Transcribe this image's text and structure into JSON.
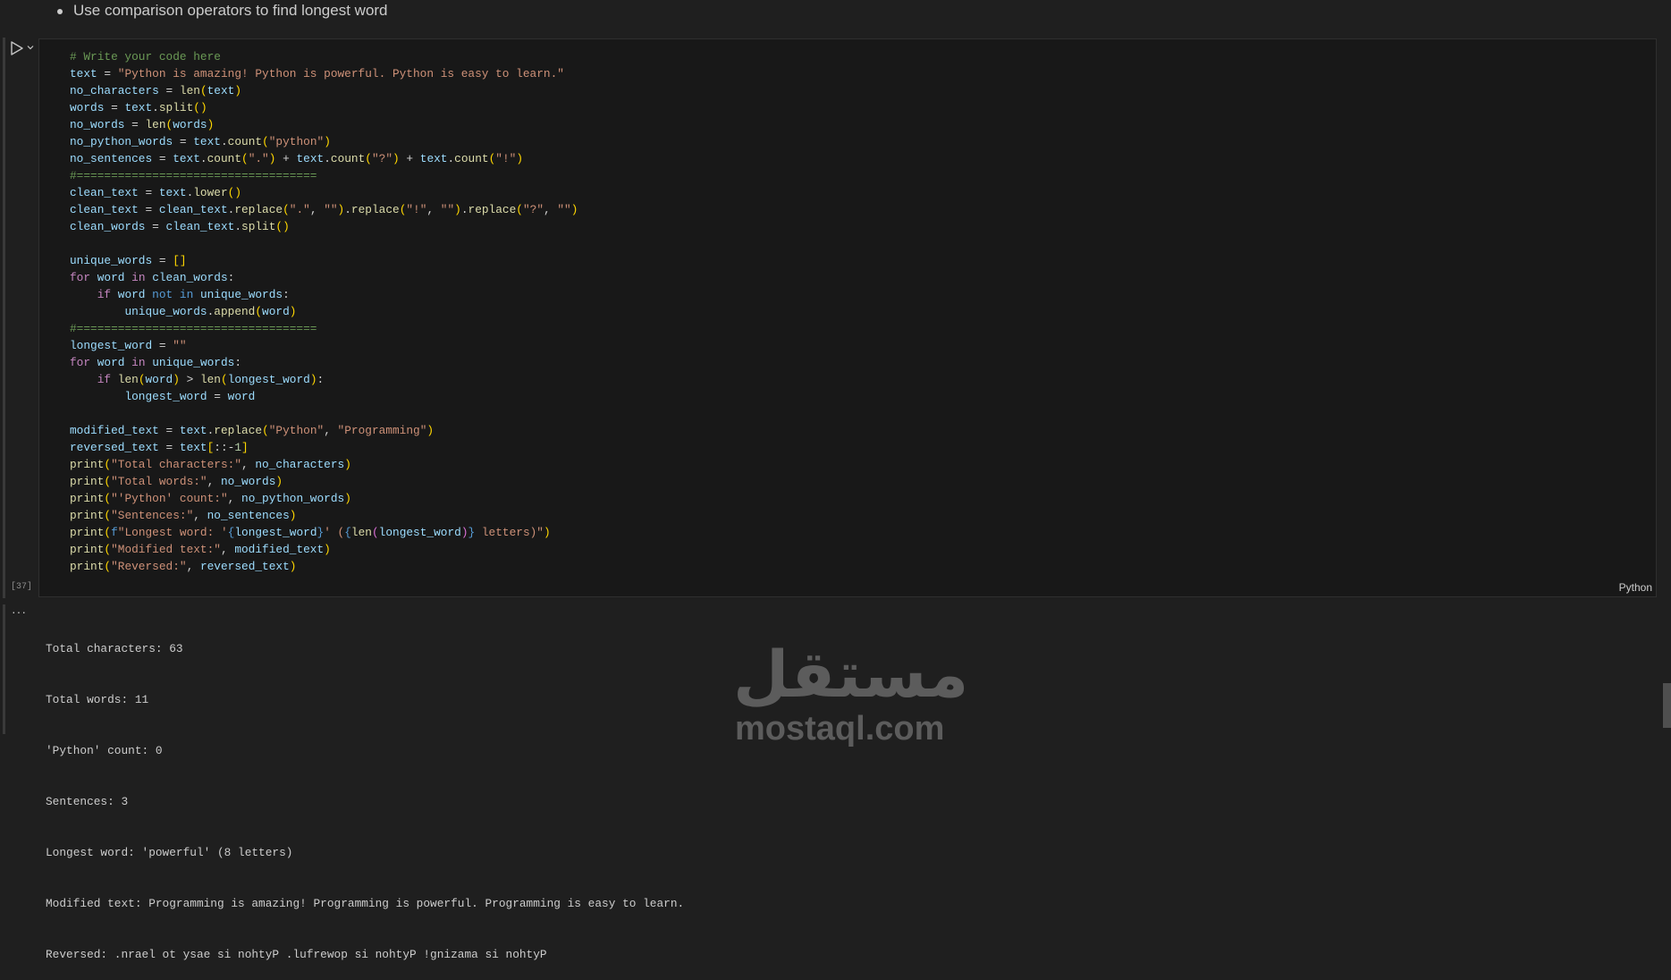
{
  "markdown": {
    "bullet_text": "Use comparison operators to find longest word"
  },
  "cell": {
    "execution_count": "[37]",
    "language": "Python",
    "code_lines": [
      [
        [
          "# Write your code here",
          "c"
        ]
      ],
      [
        [
          "text",
          "v"
        ],
        [
          " = ",
          "p"
        ],
        [
          "\"Python is amazing! Python is powerful. Python is easy to learn.\"",
          "s"
        ]
      ],
      [
        [
          "no_characters",
          "v"
        ],
        [
          " = ",
          "p"
        ],
        [
          "len",
          "f"
        ],
        [
          "(",
          "y"
        ],
        [
          "text",
          "v"
        ],
        [
          ")",
          "y"
        ]
      ],
      [
        [
          "words",
          "v"
        ],
        [
          " = ",
          "p"
        ],
        [
          "text",
          "v"
        ],
        [
          ".",
          "p"
        ],
        [
          "split",
          "f"
        ],
        [
          "()",
          "y"
        ]
      ],
      [
        [
          "no_words",
          "v"
        ],
        [
          " = ",
          "p"
        ],
        [
          "len",
          "f"
        ],
        [
          "(",
          "y"
        ],
        [
          "words",
          "v"
        ],
        [
          ")",
          "y"
        ]
      ],
      [
        [
          "no_python_words",
          "v"
        ],
        [
          " = ",
          "p"
        ],
        [
          "text",
          "v"
        ],
        [
          ".",
          "p"
        ],
        [
          "count",
          "f"
        ],
        [
          "(",
          "y"
        ],
        [
          "\"python\"",
          "s"
        ],
        [
          ")",
          "y"
        ]
      ],
      [
        [
          "no_sentences",
          "v"
        ],
        [
          " = ",
          "p"
        ],
        [
          "text",
          "v"
        ],
        [
          ".",
          "p"
        ],
        [
          "count",
          "f"
        ],
        [
          "(",
          "y"
        ],
        [
          "\".\"",
          "s"
        ],
        [
          ")",
          "y"
        ],
        [
          " + ",
          "p"
        ],
        [
          "text",
          "v"
        ],
        [
          ".",
          "p"
        ],
        [
          "count",
          "f"
        ],
        [
          "(",
          "y"
        ],
        [
          "\"?\"",
          "s"
        ],
        [
          ")",
          "y"
        ],
        [
          " + ",
          "p"
        ],
        [
          "text",
          "v"
        ],
        [
          ".",
          "p"
        ],
        [
          "count",
          "f"
        ],
        [
          "(",
          "y"
        ],
        [
          "\"!\"",
          "s"
        ],
        [
          ")",
          "y"
        ]
      ],
      [
        [
          "#===================================",
          "c"
        ]
      ],
      [
        [
          "clean_text",
          "v"
        ],
        [
          " = ",
          "p"
        ],
        [
          "text",
          "v"
        ],
        [
          ".",
          "p"
        ],
        [
          "lower",
          "f"
        ],
        [
          "()",
          "y"
        ]
      ],
      [
        [
          "clean_text",
          "v"
        ],
        [
          " = ",
          "p"
        ],
        [
          "clean_text",
          "v"
        ],
        [
          ".",
          "p"
        ],
        [
          "replace",
          "f"
        ],
        [
          "(",
          "y"
        ],
        [
          "\".\"",
          "s"
        ],
        [
          ", ",
          "p"
        ],
        [
          "\"\"",
          "s"
        ],
        [
          ")",
          "y"
        ],
        [
          ".",
          "p"
        ],
        [
          "replace",
          "f"
        ],
        [
          "(",
          "y"
        ],
        [
          "\"!\"",
          "s"
        ],
        [
          ", ",
          "p"
        ],
        [
          "\"\"",
          "s"
        ],
        [
          ")",
          "y"
        ],
        [
          ".",
          "p"
        ],
        [
          "replace",
          "f"
        ],
        [
          "(",
          "y"
        ],
        [
          "\"?\"",
          "s"
        ],
        [
          ", ",
          "p"
        ],
        [
          "\"\"",
          "s"
        ],
        [
          ")",
          "y"
        ]
      ],
      [
        [
          "clean_words",
          "v"
        ],
        [
          " = ",
          "p"
        ],
        [
          "clean_text",
          "v"
        ],
        [
          ".",
          "p"
        ],
        [
          "split",
          "f"
        ],
        [
          "()",
          "y"
        ]
      ],
      [],
      [
        [
          "unique_words",
          "v"
        ],
        [
          " = ",
          "p"
        ],
        [
          "[]",
          "y"
        ]
      ],
      [
        [
          "for",
          "k"
        ],
        [
          " ",
          "p"
        ],
        [
          "word",
          "v"
        ],
        [
          " ",
          "p"
        ],
        [
          "in",
          "k"
        ],
        [
          " ",
          "p"
        ],
        [
          "clean_words",
          "v"
        ],
        [
          ":",
          "p"
        ]
      ],
      [
        [
          "    ",
          "p"
        ],
        [
          "if",
          "k"
        ],
        [
          " ",
          "p"
        ],
        [
          "word",
          "v"
        ],
        [
          " ",
          "p"
        ],
        [
          "not in",
          "b"
        ],
        [
          " ",
          "p"
        ],
        [
          "unique_words",
          "v"
        ],
        [
          ":",
          "p"
        ]
      ],
      [
        [
          "        ",
          "p"
        ],
        [
          "unique_words",
          "v"
        ],
        [
          ".",
          "p"
        ],
        [
          "append",
          "f"
        ],
        [
          "(",
          "y"
        ],
        [
          "word",
          "v"
        ],
        [
          ")",
          "y"
        ]
      ],
      [
        [
          "#===================================",
          "c"
        ]
      ],
      [
        [
          "longest_word",
          "v"
        ],
        [
          " = ",
          "p"
        ],
        [
          "\"\"",
          "s"
        ]
      ],
      [
        [
          "for",
          "k"
        ],
        [
          " ",
          "p"
        ],
        [
          "word",
          "v"
        ],
        [
          " ",
          "p"
        ],
        [
          "in",
          "k"
        ],
        [
          " ",
          "p"
        ],
        [
          "unique_words",
          "v"
        ],
        [
          ":",
          "p"
        ]
      ],
      [
        [
          "    ",
          "p"
        ],
        [
          "if",
          "k"
        ],
        [
          " ",
          "p"
        ],
        [
          "len",
          "f"
        ],
        [
          "(",
          "y"
        ],
        [
          "word",
          "v"
        ],
        [
          ")",
          "y"
        ],
        [
          " > ",
          "p"
        ],
        [
          "len",
          "f"
        ],
        [
          "(",
          "y"
        ],
        [
          "longest_word",
          "v"
        ],
        [
          ")",
          "y"
        ],
        [
          ":",
          "p"
        ]
      ],
      [
        [
          "        ",
          "p"
        ],
        [
          "longest_word",
          "v"
        ],
        [
          " = ",
          "p"
        ],
        [
          "word",
          "v"
        ]
      ],
      [],
      [
        [
          "modified_text",
          "v"
        ],
        [
          " = ",
          "p"
        ],
        [
          "text",
          "v"
        ],
        [
          ".",
          "p"
        ],
        [
          "replace",
          "f"
        ],
        [
          "(",
          "y"
        ],
        [
          "\"Python\"",
          "s"
        ],
        [
          ", ",
          "p"
        ],
        [
          "\"Programming\"",
          "s"
        ],
        [
          ")",
          "y"
        ]
      ],
      [
        [
          "reversed_text",
          "v"
        ],
        [
          " = ",
          "p"
        ],
        [
          "text",
          "v"
        ],
        [
          "[",
          "y"
        ],
        [
          "::-",
          "p"
        ],
        [
          "1",
          "n"
        ],
        [
          "]",
          "y"
        ]
      ],
      [
        [
          "print",
          "f"
        ],
        [
          "(",
          "y"
        ],
        [
          "\"Total characters:\"",
          "s"
        ],
        [
          ", ",
          "p"
        ],
        [
          "no_characters",
          "v"
        ],
        [
          ")",
          "y"
        ]
      ],
      [
        [
          "print",
          "f"
        ],
        [
          "(",
          "y"
        ],
        [
          "\"Total words:\"",
          "s"
        ],
        [
          ", ",
          "p"
        ],
        [
          "no_words",
          "v"
        ],
        [
          ")",
          "y"
        ]
      ],
      [
        [
          "print",
          "f"
        ],
        [
          "(",
          "y"
        ],
        [
          "\"'Python' count:\"",
          "s"
        ],
        [
          ", ",
          "p"
        ],
        [
          "no_python_words",
          "v"
        ],
        [
          ")",
          "y"
        ]
      ],
      [
        [
          "print",
          "f"
        ],
        [
          "(",
          "y"
        ],
        [
          "\"Sentences:\"",
          "s"
        ],
        [
          ", ",
          "p"
        ],
        [
          "no_sentences",
          "v"
        ],
        [
          ")",
          "y"
        ]
      ],
      [
        [
          "print",
          "f"
        ],
        [
          "(",
          "y"
        ],
        [
          "f",
          "b"
        ],
        [
          "\"Longest word: '",
          "s"
        ],
        [
          "{",
          "b"
        ],
        [
          "longest_word",
          "v"
        ],
        [
          "}",
          "b"
        ],
        [
          "' (",
          "s"
        ],
        [
          "{",
          "b"
        ],
        [
          "len",
          "f"
        ],
        [
          "(",
          "m"
        ],
        [
          "longest_word",
          "v"
        ],
        [
          ")",
          "m"
        ],
        [
          "}",
          "b"
        ],
        [
          " letters)\"",
          "s"
        ],
        [
          ")",
          "y"
        ]
      ],
      [
        [
          "print",
          "f"
        ],
        [
          "(",
          "y"
        ],
        [
          "\"Modified text:\"",
          "s"
        ],
        [
          ", ",
          "p"
        ],
        [
          "modified_text",
          "v"
        ],
        [
          ")",
          "y"
        ]
      ],
      [
        [
          "print",
          "f"
        ],
        [
          "(",
          "y"
        ],
        [
          "\"Reversed:\"",
          "s"
        ],
        [
          ", ",
          "p"
        ],
        [
          "reversed_text",
          "v"
        ],
        [
          ")",
          "y"
        ]
      ]
    ]
  },
  "output": {
    "more_label": "···",
    "lines": [
      "Total characters: 63",
      "Total words: 11",
      "'Python' count: 0",
      "Sentences: 3",
      "Longest word: 'powerful' (8 letters)",
      "Modified text: Programming is amazing! Programming is powerful. Programming is easy to learn.",
      "Reversed: .nrael ot ysae si nohtyP .lufrewop si nohtyP !gnizama si nohtyP"
    ]
  },
  "watermark": {
    "arabic": "مستقل",
    "latin": "mostaql.com"
  },
  "colors": {
    "background": "#1f1f1f",
    "cell_background": "#181818"
  }
}
